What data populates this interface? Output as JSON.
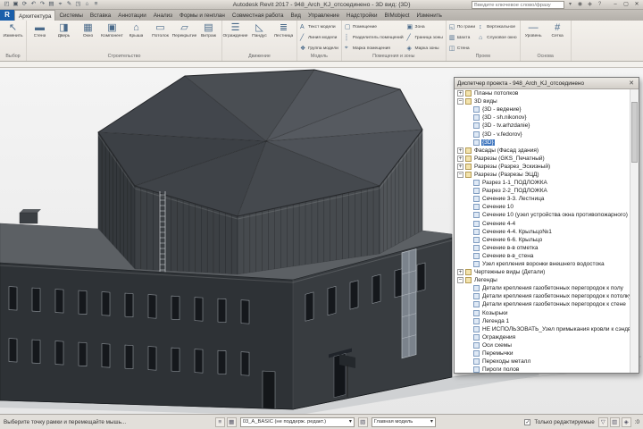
{
  "window": {
    "title": "Autodesk Revit 2017 - 948_Arch_KJ_отсоединено - 3D вид: {3D}",
    "search_placeholder": "Введите ключевое слово/фразу",
    "app_button": "R"
  },
  "icons": {
    "qat": [
      {
        "name": "open-icon",
        "glyph": "◰"
      },
      {
        "name": "save-icon",
        "glyph": "▣"
      },
      {
        "name": "sync-icon",
        "glyph": "⟳"
      },
      {
        "name": "undo-icon",
        "glyph": "↶"
      },
      {
        "name": "redo-icon",
        "glyph": "↷"
      },
      {
        "name": "print-icon",
        "glyph": "▤"
      },
      {
        "name": "measure-icon",
        "glyph": "⌖"
      },
      {
        "name": "tag-icon",
        "glyph": "✎"
      },
      {
        "name": "section-icon",
        "glyph": "◳"
      },
      {
        "name": "default-3d-view-icon",
        "glyph": "⌂"
      },
      {
        "name": "thin-lines-icon",
        "glyph": "≡"
      }
    ],
    "titlebar_right": [
      {
        "name": "signin-icon",
        "glyph": "◉"
      },
      {
        "name": "exchange-apps-icon",
        "glyph": "◈"
      },
      {
        "name": "help-icon",
        "glyph": "?"
      }
    ],
    "window_controls": [
      {
        "name": "minimize-button",
        "glyph": "–"
      },
      {
        "name": "maximize-button",
        "glyph": "▢"
      },
      {
        "name": "close-button",
        "glyph": "✕"
      }
    ],
    "search_icon_glyph": "▾",
    "panel_close_glyph": "✕",
    "status_left_icons": [
      {
        "name": "worksets-icon",
        "glyph": "≡"
      },
      {
        "name": "workset-display-icon",
        "glyph": "▦"
      }
    ],
    "status_mid_icons": [
      {
        "name": "design-options-icon",
        "glyph": "▧"
      }
    ],
    "status_right_icons": [
      {
        "name": "filter-funnel-icon",
        "glyph": "▽"
      },
      {
        "name": "select-toggle-icon",
        "glyph": "▥"
      },
      {
        "name": "background-process-icon",
        "glyph": "◈"
      }
    ],
    "ribbon_glyphs": {
      "cursor": "↖",
      "wall": "▬",
      "door": "◨",
      "window": "▦",
      "component": "▣",
      "roof": "⌂",
      "ceiling": "▭",
      "floor": "▱",
      "curtain": "▤",
      "railing": "☰",
      "ramp": "◺",
      "stair": "≣",
      "text": "A",
      "line": "╱",
      "group": "❖",
      "room": "▢",
      "separator": "┊",
      "tag": "⌖",
      "area": "▣",
      "areatag": "◈",
      "face": "◱",
      "shaft": "▥",
      "wallopen": "◫",
      "vertical": "↕",
      "dormer": "⌂",
      "level": "—",
      "gridline": "#"
    }
  },
  "ribbon": {
    "tabs": [
      {
        "label": "Архитектура",
        "active": true
      },
      {
        "label": "Системы",
        "active": false
      },
      {
        "label": "Вставка",
        "active": false
      },
      {
        "label": "Аннотации",
        "active": false
      },
      {
        "label": "Анализ",
        "active": false
      },
      {
        "label": "Формы и генплан",
        "active": false
      },
      {
        "label": "Совместная работа",
        "active": false
      },
      {
        "label": "Вид",
        "active": false
      },
      {
        "label": "Управление",
        "active": false
      },
      {
        "label": "Надстройки",
        "active": false
      },
      {
        "label": "BIMobject",
        "active": false
      },
      {
        "label": "Изменить",
        "active": false
      }
    ],
    "groups": [
      {
        "label": "Выбор",
        "layout": "big",
        "buttons": [
          {
            "label": "Изменить",
            "icon": "cursor"
          }
        ]
      },
      {
        "label": "Строительство",
        "layout": "big",
        "buttons": [
          {
            "label": "Стена",
            "icon": "wall"
          },
          {
            "label": "Дверь",
            "icon": "door"
          },
          {
            "label": "Окно",
            "icon": "window"
          },
          {
            "label": "Компонент",
            "icon": "component"
          },
          {
            "label": "Крыша",
            "icon": "roof"
          },
          {
            "label": "Потолок",
            "icon": "ceiling"
          },
          {
            "label": "Перекрытие",
            "icon": "floor"
          },
          {
            "label": "Витраж",
            "icon": "curtain"
          }
        ]
      },
      {
        "label": "Движение",
        "layout": "big",
        "buttons": [
          {
            "label": "Ограждение",
            "icon": "railing"
          },
          {
            "label": "Пандус",
            "icon": "ramp"
          },
          {
            "label": "Лестница",
            "icon": "stair"
          }
        ]
      },
      {
        "label": "Модель",
        "layout": "stack",
        "buttons": [
          {
            "label": "Текст модели",
            "icon": "text"
          },
          {
            "label": "Линия модели",
            "icon": "line"
          },
          {
            "label": "Группа модели",
            "icon": "group"
          }
        ]
      },
      {
        "label": "Помещения и зоны",
        "layout": "stack",
        "buttons": [
          {
            "label": "Помещение",
            "icon": "room"
          },
          {
            "label": "Разделитель помещений",
            "icon": "separator"
          },
          {
            "label": "Марка помещения",
            "icon": "tag"
          },
          {
            "label": "Зона",
            "icon": "area"
          },
          {
            "label": "Граница зоны",
            "icon": "line"
          },
          {
            "label": "Марка зоны",
            "icon": "areatag"
          }
        ]
      },
      {
        "label": "Проем",
        "layout": "stack",
        "buttons": [
          {
            "label": "По грани",
            "icon": "face"
          },
          {
            "label": "Шахта",
            "icon": "shaft"
          },
          {
            "label": "Стена",
            "icon": "wallopen"
          },
          {
            "label": "Вертикальное",
            "icon": "vertical"
          },
          {
            "label": "Слуховое окно",
            "icon": "dormer"
          }
        ]
      },
      {
        "label": "Основа",
        "layout": "big",
        "buttons": [
          {
            "label": "Уровень",
            "icon": "level"
          },
          {
            "label": "Сетка",
            "icon": "gridline"
          }
        ]
      }
    ]
  },
  "browser": {
    "title": "Диспетчер проекта - 948_Arch_KJ_отсоединено",
    "tree": [
      {
        "label": "Планы потолков",
        "depth": 0,
        "expand": "plus",
        "selected": false
      },
      {
        "label": "3D виды",
        "depth": 0,
        "expand": "minus",
        "selected": false
      },
      {
        "label": "{3D - ведение}",
        "depth": 1,
        "expand": null,
        "selected": false
      },
      {
        "label": "{3D - sh.nikonov}",
        "depth": 1,
        "expand": null,
        "selected": false
      },
      {
        "label": "{3D - tv.arhzdanie}",
        "depth": 1,
        "expand": null,
        "selected": false
      },
      {
        "label": "{3D - v.fedorov}",
        "depth": 1,
        "expand": null,
        "selected": false
      },
      {
        "label": "{3D}",
        "depth": 1,
        "expand": null,
        "selected": true
      },
      {
        "label": "Фасады (Фасад здания)",
        "depth": 0,
        "expand": "plus",
        "selected": false
      },
      {
        "label": "Разрезы (GKS_Печатный)",
        "depth": 0,
        "expand": "plus",
        "selected": false
      },
      {
        "label": "Разрезы (Разрез_Эскизный)",
        "depth": 0,
        "expand": "plus",
        "selected": false
      },
      {
        "label": "Разрезы (Разрезы ЭЦД)",
        "depth": 0,
        "expand": "minus",
        "selected": false
      },
      {
        "label": "Разрез 1-1_ПОДЛОЖКА",
        "depth": 1,
        "expand": null,
        "selected": false
      },
      {
        "label": "Разрез 2-2_ПОДЛОЖКА",
        "depth": 1,
        "expand": null,
        "selected": false
      },
      {
        "label": "Сечение 3-3. Лестница",
        "depth": 1,
        "expand": null,
        "selected": false
      },
      {
        "label": "Сечение 10",
        "depth": 1,
        "expand": null,
        "selected": false
      },
      {
        "label": "Сечение 10 (узел устройства окна противопожарного)",
        "depth": 1,
        "expand": null,
        "selected": false
      },
      {
        "label": "Сечение 4-4",
        "depth": 1,
        "expand": null,
        "selected": false
      },
      {
        "label": "Сечение 4-4. Крыльцо№1",
        "depth": 1,
        "expand": null,
        "selected": false
      },
      {
        "label": "Сечение 6-6. Крыльцо",
        "depth": 1,
        "expand": null,
        "selected": false
      },
      {
        "label": "Сечение в-в отметка",
        "depth": 1,
        "expand": null,
        "selected": false
      },
      {
        "label": "Сечение в-в_стена",
        "depth": 1,
        "expand": null,
        "selected": false
      },
      {
        "label": "Узел крепления воронки внешнего водостока",
        "depth": 1,
        "expand": null,
        "selected": false
      },
      {
        "label": "Чертежные виды (Детали)",
        "depth": 0,
        "expand": "plus",
        "selected": false
      },
      {
        "label": "Легенды",
        "depth": 0,
        "expand": "minus",
        "selected": false
      },
      {
        "label": "Детали крепления газобетонных перегородок к полу",
        "depth": 1,
        "expand": null,
        "selected": false
      },
      {
        "label": "Детали крепления газобетонных перегородок к потолку",
        "depth": 1,
        "expand": null,
        "selected": false
      },
      {
        "label": "Детали крепления газобетонных перегородок к стене",
        "depth": 1,
        "expand": null,
        "selected": false
      },
      {
        "label": "Козырьки",
        "depth": 1,
        "expand": null,
        "selected": false
      },
      {
        "label": "Легенда 1",
        "depth": 1,
        "expand": null,
        "selected": false
      },
      {
        "label": "НЕ ИСПОЛЬЗОВАТЬ_Узел примыкания кровли к сэндвич-панели",
        "depth": 1,
        "expand": null,
        "selected": false
      },
      {
        "label": "Ограждения",
        "depth": 1,
        "expand": null,
        "selected": false
      },
      {
        "label": "Оси схемы",
        "depth": 1,
        "expand": null,
        "selected": false
      },
      {
        "label": "Перемычки",
        "depth": 1,
        "expand": null,
        "selected": false
      },
      {
        "label": "Переходы металл",
        "depth": 1,
        "expand": null,
        "selected": false
      },
      {
        "label": "Пироги полов",
        "depth": 1,
        "expand": null,
        "selected": false
      }
    ]
  },
  "status_bar": {
    "hint": "Выберите точку рамки и перемещайте мышь...",
    "workset": "03_A_BASIC (не поддерж. редакт.)",
    "model": "Главная модель",
    "editable_only": "Только редактируемые",
    "filter_count": ":0",
    "dropdown_arrow": "▾"
  },
  "colors": {
    "accent": "#1b5faa",
    "selection": "#3f76bf",
    "viewport_bg": "#ececec",
    "roof_line": "#26282b",
    "wall_dark": "#34383c",
    "wall_front": "#3c4044",
    "wall_right": "#464a4e",
    "wall_far": "#505458",
    "roof_band": "#5c6064",
    "facade_front": "#2e3236",
    "facade_right": "#383c40",
    "window_glass": "#15181c",
    "window_frame": "#90969c",
    "glazing": "#7b838c",
    "ground_shadow": "#c7cacc"
  }
}
